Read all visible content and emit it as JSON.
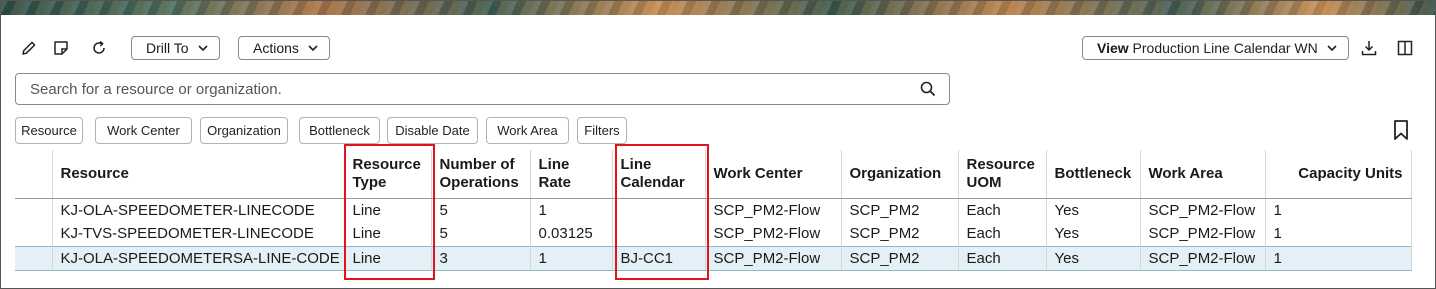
{
  "toolbar": {
    "edit_icon": "pencil-icon",
    "note_icon": "sticky-note-icon",
    "refresh_icon": "refresh-icon",
    "drill_to_label": "Drill To",
    "actions_label": "Actions",
    "view_prefix": "View",
    "view_value": "Production Line Calendar WN",
    "download_icon": "download-icon",
    "columns_icon": "panel-columns-icon"
  },
  "search": {
    "placeholder": "Search for a resource or organization."
  },
  "filters": {
    "chips": [
      "Resource",
      "Work Center",
      "Organization",
      "Bottleneck",
      "Disable Date",
      "Work Area",
      "Filters"
    ]
  },
  "table": {
    "columns": [
      "",
      "Resource",
      "Resource Type",
      "Number of Operations",
      "Line Rate",
      "Line Calendar",
      "Work Center",
      "Organization",
      "Resource UOM",
      "Bottleneck",
      "Work Area",
      "Capacity Units"
    ],
    "rows": [
      [
        "KJ-OLA-SPEEDOMETER-LINECODE",
        "Line",
        "5",
        "1",
        "",
        "SCP_PM2-Flow",
        "SCP_PM2",
        "Each",
        "Yes",
        "SCP_PM2-Flow",
        "1"
      ],
      [
        "KJ-TVS-SPEEDOMETER-LINECODE",
        "Line",
        "5",
        "0.03125",
        "",
        "SCP_PM2-Flow",
        "SCP_PM2",
        "Each",
        "Yes",
        "SCP_PM2-Flow",
        "1"
      ],
      [
        "KJ-OLA-SPEEDOMETERSA-LINE-CODE",
        "Line",
        "3",
        "1",
        "BJ-CC1",
        "SCP_PM2-Flow",
        "SCP_PM2",
        "Each",
        "Yes",
        "SCP_PM2-Flow",
        "1"
      ]
    ],
    "selected_row": 2
  },
  "colors": {
    "highlight": "#e0141c",
    "selected_row": "#e4f0f5"
  }
}
